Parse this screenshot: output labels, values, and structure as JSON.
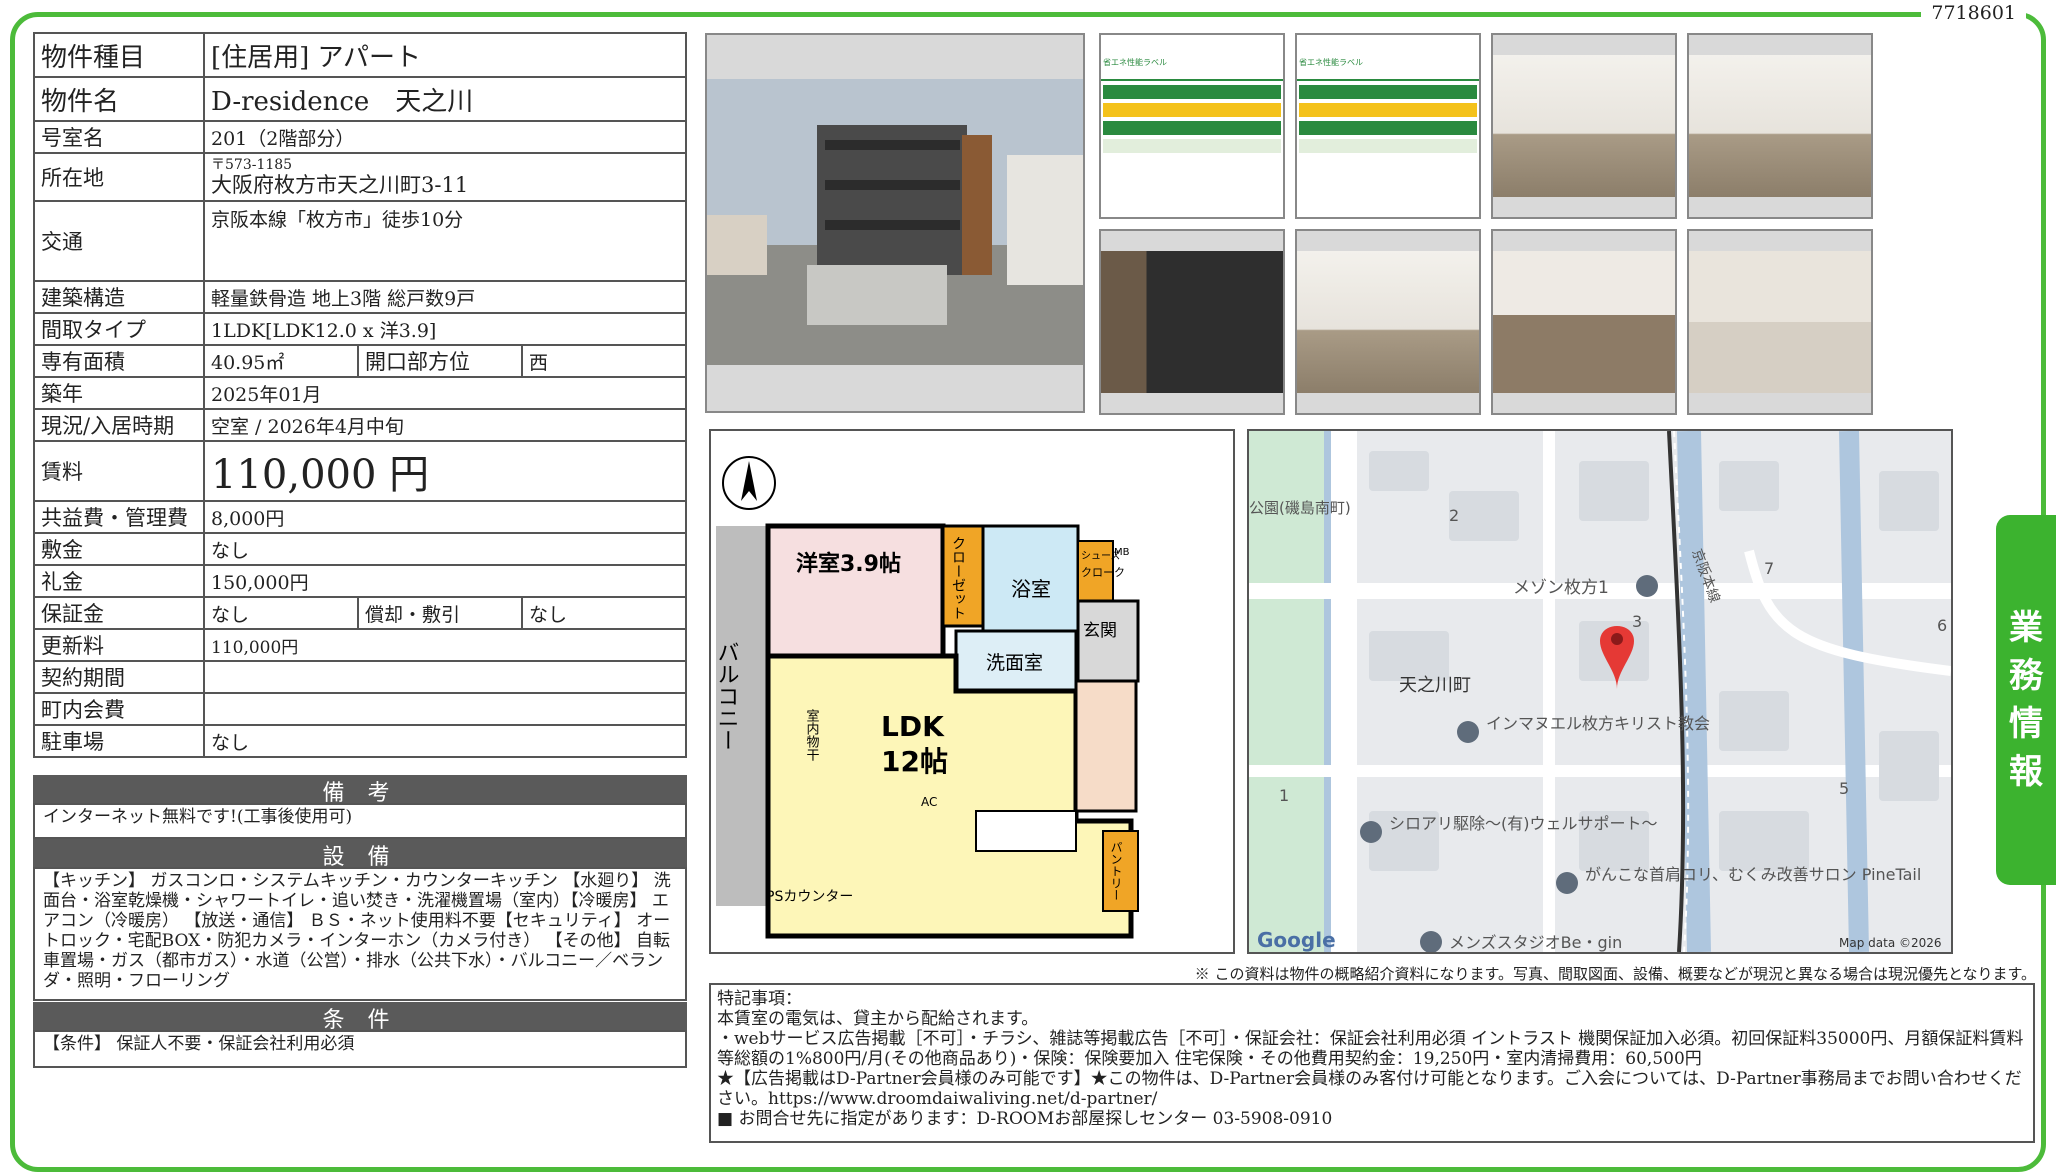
{
  "doc_id": "7718601",
  "side_tab": [
    "業",
    "務",
    "情",
    "報"
  ],
  "spec": {
    "type_label": "物件種目",
    "type_value": "[住居用] アパート",
    "name_label": "物件名",
    "name_value": "D-residence　天之川",
    "room_label": "号室名",
    "room_value": "201（2階部分）",
    "address_label": "所在地",
    "address_zip": "〒573-1185",
    "address_value": "大阪府枚方市天之川町3-11",
    "transit_label": "交通",
    "transit_value": "京阪本線「枚方市」徒歩10分",
    "structure_label": "建築構造",
    "structure_value": "軽量鉄骨造 地上3階 総戸数9戸",
    "layout_label": "間取タイプ",
    "layout_value": "1LDK[LDK12.0 x 洋3.9]",
    "area_label": "専有面積",
    "area_value": "40.95㎡",
    "facing_label": "開口部方位",
    "facing_value": "西",
    "built_label": "築年",
    "built_value": "2025年01月",
    "status_label": "現況/入居時期",
    "status_value": "空室 / 2026年4月中旬",
    "rent_label": "賃料",
    "rent_value": "110,000 円",
    "fee_label": "共益費・管理費",
    "fee_value": "8,000円",
    "deposit_label": "敷金",
    "deposit_value": "なし",
    "key_money_label": "礼金",
    "key_money_value": "150,000円",
    "guarantee_label": "保証金",
    "guarantee_value": "なし",
    "amort_label": "償却・敷引",
    "amort_value": "なし",
    "renewal_label": "更新料",
    "renewal_value": "110,000円",
    "contract_label": "契約期間",
    "contract_value": "",
    "town_fee_label": "町内会費",
    "town_fee_value": "",
    "parking_label": "駐車場",
    "parking_value": "なし"
  },
  "bikou": {
    "title": "備 考",
    "text": "インターネット無料です!(工事後使用可)"
  },
  "setsubi": {
    "title": "設 備",
    "text": "【キッチン】 ガスコンロ・システムキッチン・カウンターキッチン 【水廻り】 洗面台・浴室乾燥機・シャワートイレ・追い焚き・洗濯機置場（室内）【冷暖房】 エアコン（冷暖房） 【放送・通信】 ＢＳ・ネット使用料不要【セキュリティ】 オートロック・宅配BOX・防犯カメラ・インターホン（カメラ付き） 【その他】 自転車置場・ガス（都市ガス）・水道（公営）・排水（公共下水）・バルコニー／ベランダ・照明・フローリング"
  },
  "joken": {
    "title": "条 件",
    "text": "【条件】 保証人不要・保証会社利用必須"
  },
  "floorplan": {
    "western": "洋室3.9帖",
    "closet": "クローゼット",
    "bath": "浴室",
    "washroom": "洗面室",
    "shoes": "シューズ",
    "cloak": "クローク",
    "mb": "MB",
    "entrance": "玄関",
    "balcony": "バルコニー",
    "ldk": "LDK",
    "ldk_size": "12帖",
    "laundry": "室内物干",
    "ac": "AC",
    "pantry": "パントリー",
    "ps": "PSカウンター"
  },
  "map": {
    "park": "公園(磯島南町)",
    "mansion": "メゾン枚方1",
    "town": "天之川町",
    "church": "インマヌエル枚方キリスト教会",
    "shop1": "シロアリ駆除〜(有)ウェルサポート〜",
    "shop2": "がんこな首肩コリ、むくみ改善サロン PineTail",
    "shop3": "メンズスタジオBe・gin",
    "rail": "京阪本線",
    "num1": "1",
    "num2": "2",
    "num3": "3",
    "num5": "5",
    "num6": "6",
    "num7": "7",
    "logo": "Google",
    "credit": "Map data ©2026"
  },
  "disclaimer": "※ この資料は物件の概略紹介資料になります。写真、間取図面、設備、概要などが現況と異なる場合は現況優先となります。",
  "remarks": {
    "head": "特記事項：",
    "l1": "本賃室の電気は、貸主から配給されます。",
    "l2": "・webサービス広告掲載［不可］・チラシ、雑誌等掲載広告［不可］・保証会社：保証会社利用必須 イントラスト 機関保証加入必須。初回保証料35000円、月額保証料賃料等総額の1%800円/月(その他商品あり)・保険：保険要加入 住宅保険・その他費用契約金：19,250円・室内清掃費用：60,500円",
    "l3": "★【広告掲載はD-Partner会員様のみ可能です】★この物件は、D-Partner会員様のみ客付け可能となります。ご入会については、D-Partner事務局までお問い合わせください。https://www.droomdaiwaliving.net/d-partner/",
    "l4": "■ お問合せ先に指定があります：D-ROOMお部屋探しセンター 03-5908-0910"
  },
  "photos": {
    "label_title": "省エネ性能ラベル"
  }
}
